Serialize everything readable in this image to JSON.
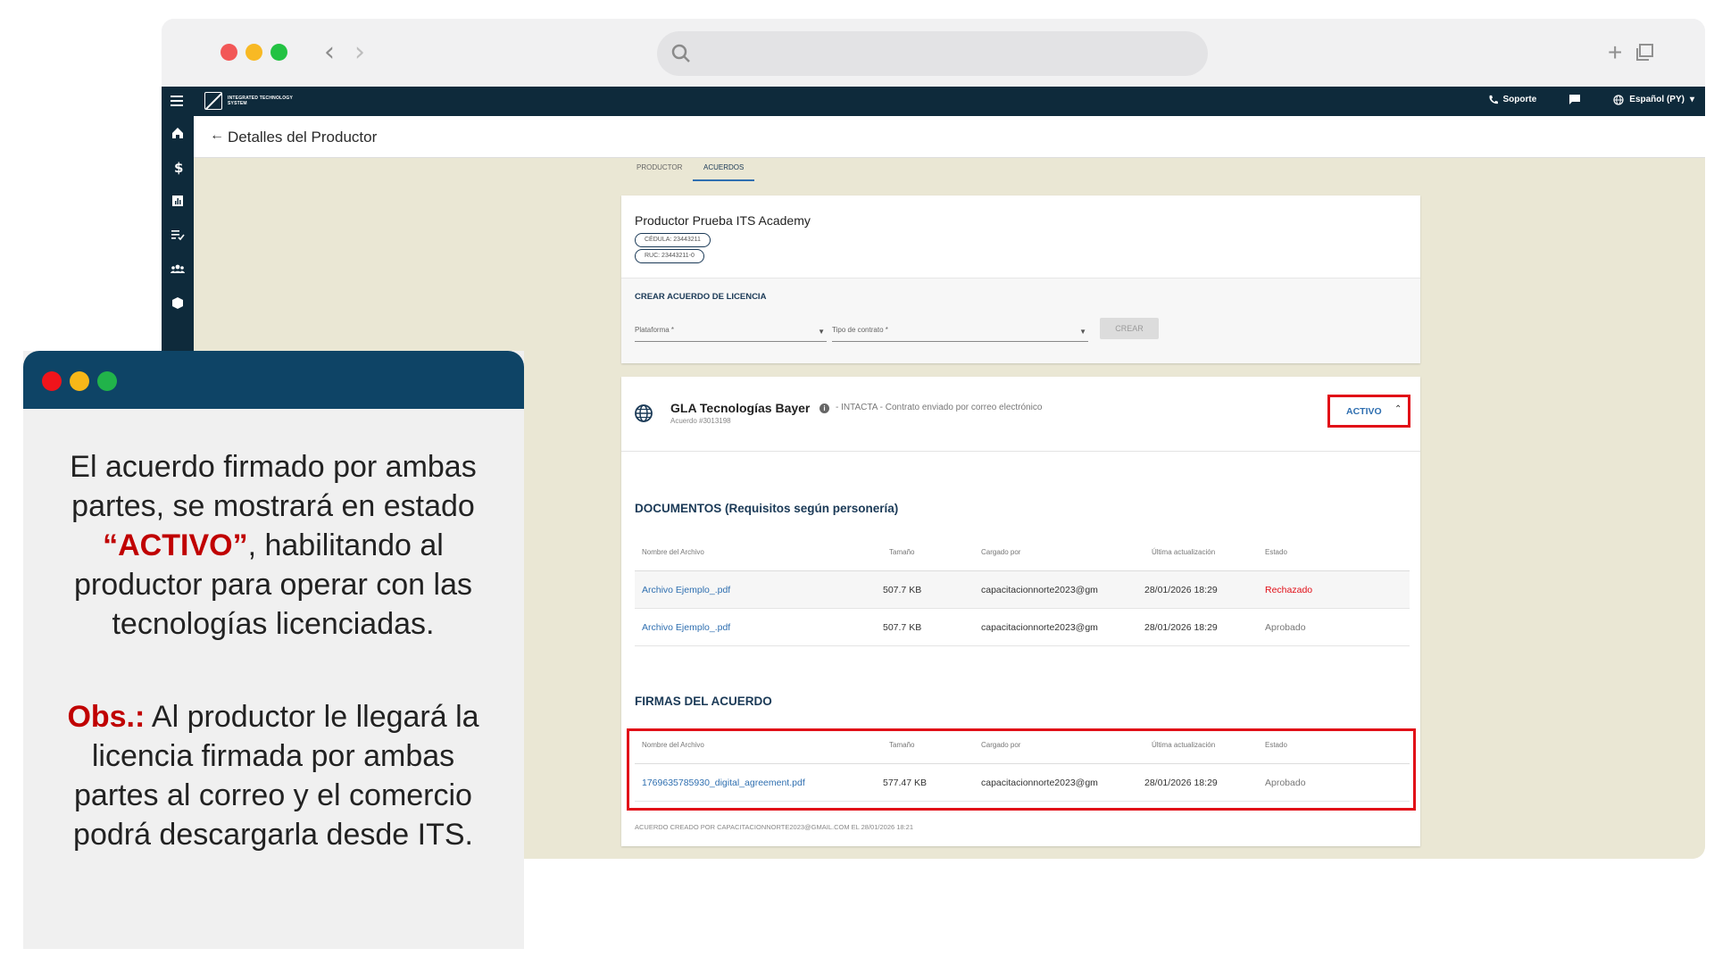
{
  "browser": {
    "search_placeholder": "",
    "new_tab_symbol": "+"
  },
  "app": {
    "logo_text": "INTEGRATED TECHNOLOGY SYSTEM",
    "support_label": "Soporte",
    "language_label": "Español (PY)",
    "page_title": "Detalles del Productor",
    "tabs": [
      {
        "label": "PRODUCTOR"
      },
      {
        "label": "ACUERDOS"
      }
    ]
  },
  "producer": {
    "name": "Productor Prueba ITS Academy",
    "cedula": "CÉDULA: 23443211",
    "ruc": "RUC: 23443211-0",
    "create_title": "CREAR ACUERDO DE LICENCIA",
    "platform_label": "Plataforma *",
    "contract_type_label": "Tipo de contrato *",
    "create_button": "CREAR"
  },
  "agreement": {
    "name": "GLA Tecnologías Bayer",
    "status_text": "- INTACTA - Contrato enviado por correo electrónico",
    "number": "Acuerdo #3013198",
    "state_label": "ACTIVO",
    "documents_title": "DOCUMENTOS (Requisitos según personería)",
    "signatures_title": "FIRMAS DEL ACUERDO",
    "columns": [
      "Nombre del Archivo",
      "Tamaño",
      "Cargado por",
      "Última actualización",
      "Estado"
    ],
    "documents": [
      {
        "file": "Archivo Ejemplo_.pdf",
        "size": "507.7 KB",
        "uploaded_by": "capacitacionnorte2023@gm",
        "updated": "28/01/2026 18:29",
        "status": "Rechazado"
      },
      {
        "file": "Archivo Ejemplo_.pdf",
        "size": "507.7 KB",
        "uploaded_by": "capacitacionnorte2023@gm",
        "updated": "28/01/2026 18:29",
        "status": "Aprobado"
      }
    ],
    "signatures": [
      {
        "file": "1769635785930_digital_agreement.pdf",
        "size": "577.47 KB",
        "uploaded_by": "capacitacionnorte2023@gm",
        "updated": "28/01/2026 18:29",
        "status": "Aprobado"
      }
    ],
    "footnote": "ACUERDO CREADO POR CAPACITACIONNORTE2023@GMAIL.COM EL 28/01/2026 18:21"
  },
  "panel": {
    "line1": "El acuerdo firmado por ambas partes, se mostrará en estado ",
    "highlight": "“ACTIVO”",
    "line1_end": ", habilitando al productor para operar con las tecnologías licenciadas.",
    "obs_label": "Obs.:",
    "obs_text": " Al productor le llegará la licencia firmada por ambas partes al correo y el comercio podrá descargarla desde ITS."
  },
  "colors": {
    "navy": "#0e2a3b",
    "panel_header": "#0e4466",
    "highlight_red": "#e10e17",
    "link_blue": "#2f6fb0",
    "content_bg": "#eae7d4"
  }
}
